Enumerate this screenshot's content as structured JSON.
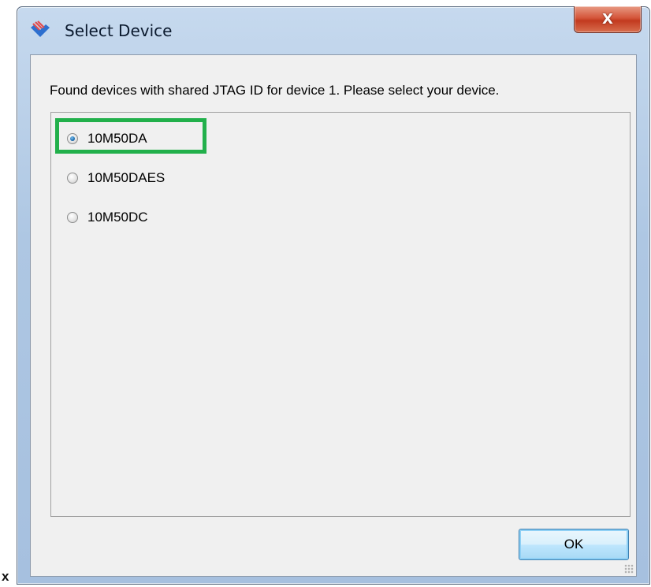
{
  "stray_glyph": "x",
  "window": {
    "title": "Select Device",
    "close_label": "X"
  },
  "dialog": {
    "instruction": "Found devices with shared JTAG ID for device 1. Please select your device.",
    "devices": [
      {
        "label": "10M50DA",
        "selected": true
      },
      {
        "label": "10M50DAES",
        "selected": false
      },
      {
        "label": "10M50DC",
        "selected": false
      }
    ],
    "ok_label": "OK"
  },
  "colors": {
    "highlight": "#22b04b",
    "title_bar": "#aec7e3",
    "client_bg": "#f0f0f0",
    "close_button": "#c23a1f"
  },
  "icons": {
    "app": "select-device-app-icon",
    "close": "close-icon",
    "grip": "resize-grip-icon"
  }
}
